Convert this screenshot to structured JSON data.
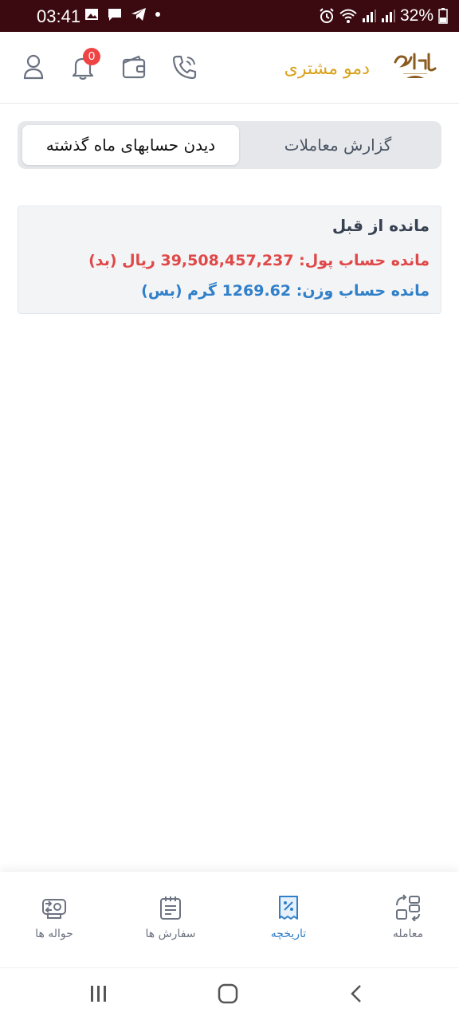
{
  "status_bar": {
    "time": "03:41",
    "battery": "32%",
    "left_icons": [
      "image-icon",
      "message-icon",
      "telegram-icon",
      "dot-icon"
    ],
    "right_icons": [
      "alarm-icon",
      "wifi-icon",
      "signal-icon",
      "signal-icon",
      "battery-icon"
    ]
  },
  "header": {
    "brand_name": "دمو مشتری",
    "notification_count": "0",
    "icons": [
      "user-icon",
      "bell-icon",
      "wallet-icon",
      "phone-icon",
      "logo"
    ]
  },
  "tabs": {
    "active_label": "دیدن حسابهای ماه گذشته",
    "inactive_label": "گزارش معاملات"
  },
  "balance_card": {
    "title": "مانده از قبل",
    "money_line": "مانده حساب پول: 39,508,457,237 ریال (بد)",
    "weight_line": "مانده حساب وزن: 1269.62 گرم (بس)"
  },
  "bottom_nav": {
    "items": [
      {
        "label": "معامله",
        "icon": "trade-icon"
      },
      {
        "label": "تاریخچه",
        "icon": "receipt-icon",
        "active": true
      },
      {
        "label": "سفارش ها",
        "icon": "orders-icon"
      },
      {
        "label": "حواله ها",
        "icon": "transfer-icon"
      }
    ]
  },
  "colors": {
    "status_bar_bg": "#3b0a10",
    "brand": "#d9a21b",
    "accent_blue": "#2f7fc9",
    "debt_red": "#e04848",
    "badge_red": "#ef4444"
  }
}
